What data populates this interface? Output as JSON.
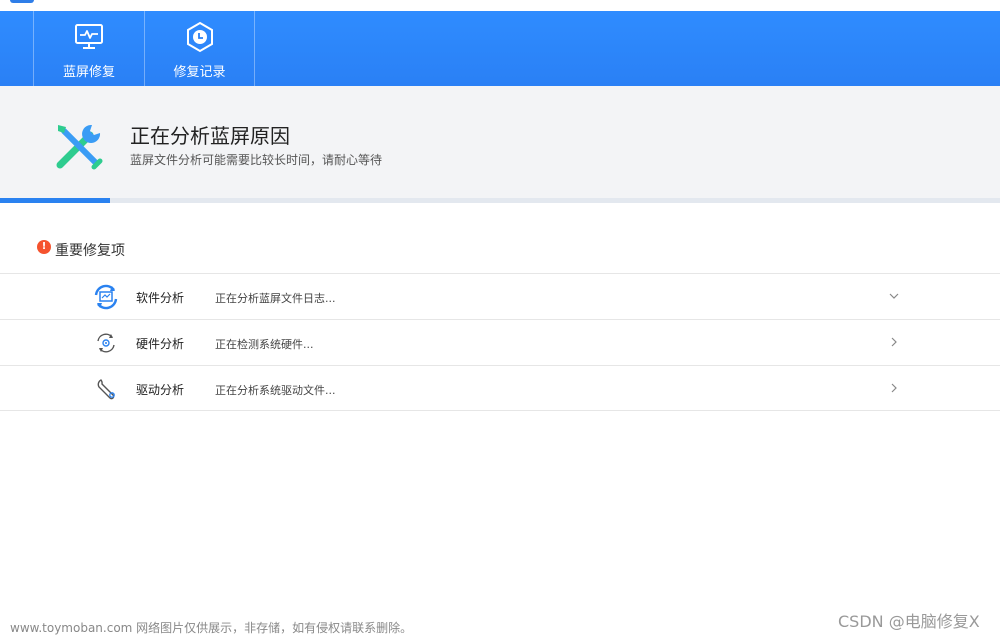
{
  "toolbar": {
    "items": [
      {
        "label": "蓝屏修复",
        "icon": "monitor-pulse-icon"
      },
      {
        "label": "修复记录",
        "icon": "clock-hexagon-icon"
      }
    ]
  },
  "status": {
    "icon": "repair-tools-icon",
    "title": "正在分析蓝屏原因",
    "subtitle": "蓝屏文件分析可能需要比较长时间，请耐心等待",
    "progress_percent": 11
  },
  "section": {
    "icon": "warning-icon",
    "icon_glyph": "!",
    "title": "重要修复项"
  },
  "items": [
    {
      "name": "软件分析",
      "status": "正在分析蓝屏文件日志...",
      "icon": "software-analysis-icon",
      "chevron": "chevron-down-icon"
    },
    {
      "name": "硬件分析",
      "status": "正在检测系统硬件...",
      "icon": "hardware-analysis-icon",
      "chevron": "chevron-right-icon"
    },
    {
      "name": "驱动分析",
      "status": "正在分析系统驱动文件...",
      "icon": "driver-analysis-icon",
      "chevron": "chevron-right-icon"
    }
  ],
  "watermark": {
    "left": "www.toymoban.com 网络图片仅供展示，非存储，如有侵权请联系删除。",
    "right": "CSDN @电脑修复X"
  },
  "colors": {
    "toolbar": "#2a80f5",
    "progress": "#2a82f0",
    "warning": "#f5532e",
    "panel": "#f3f4f6"
  }
}
